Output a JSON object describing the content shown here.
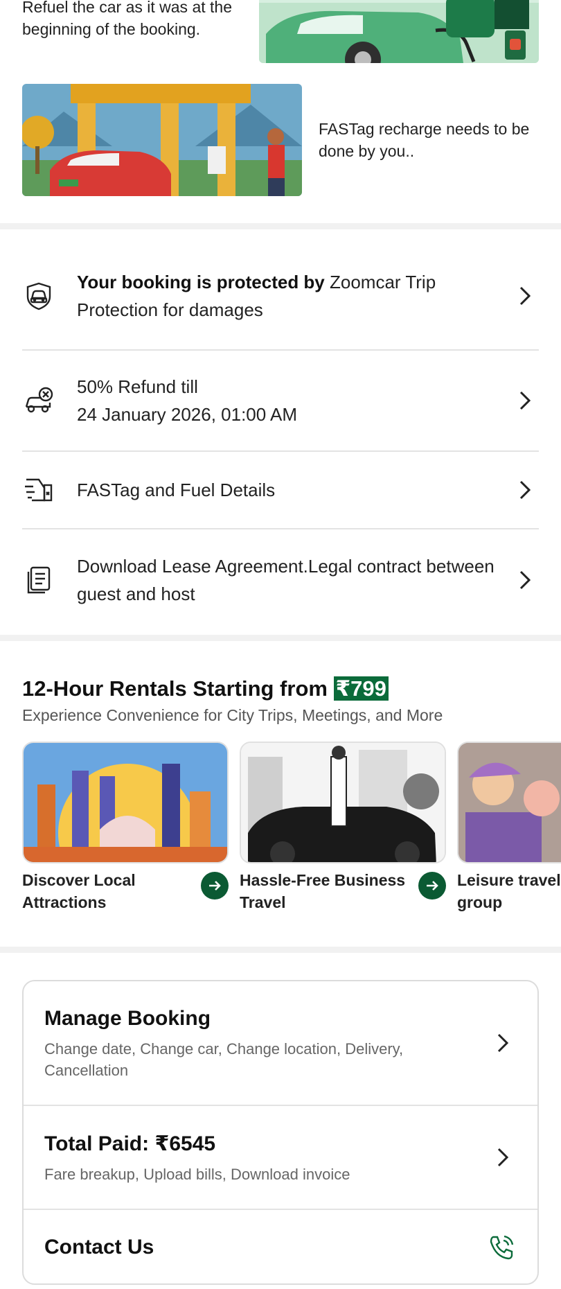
{
  "tips": {
    "fuel_text": "Refuel the car as it was at the beginning of the booking.",
    "fastag_text": "FASTag recharge needs to be done by you.."
  },
  "info_list": {
    "protection_bold": "Your booking is protected by",
    "protection_rest": " Zoomcar Trip Protection for damages",
    "refund_line1": "50% Refund till",
    "refund_line2": "24 January 2026, 01:00 AM",
    "fastag_fuel": "FASTag and Fuel Details",
    "lease": "Download Lease Agreement.Legal contract between guest and host"
  },
  "rentals": {
    "title": "12-Hour Rentals Starting from ",
    "price": "₹799",
    "subtitle": "Experience Convenience for City Trips, Meetings, and More",
    "cards": [
      {
        "label": "Discover Local Attractions"
      },
      {
        "label": "Hassle-Free Business Travel"
      },
      {
        "label": "Leisure travel with your group"
      }
    ]
  },
  "manage": {
    "manage_title": "Manage Booking",
    "manage_sub": "Change date, Change car, Change location, Delivery, Cancellation",
    "paid_title": "Total Paid: ₹6545",
    "paid_sub": "Fare breakup, Upload bills, Download invoice",
    "contact_title": "Contact Us"
  },
  "colors": {
    "accent_green": "#0b6b3a",
    "icon_green": "#0b5a33",
    "divider": "#f1f1f1"
  }
}
